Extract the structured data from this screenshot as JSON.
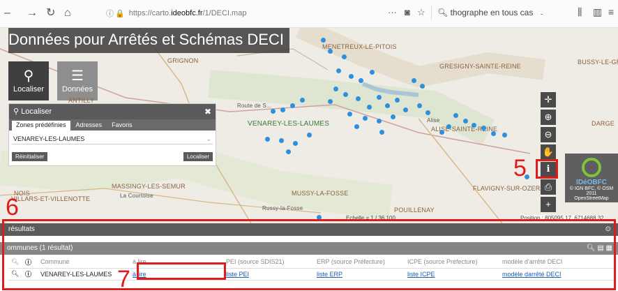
{
  "browser": {
    "url_prefix": "https://carto.",
    "url_host": "ideobfc.fr",
    "url_path": "/1/DECI.map",
    "more": "···",
    "search_text": "thographe en tous cas"
  },
  "app": {
    "title": "Données pour Arrêtés et Schémas DECI",
    "modes": [
      {
        "label": "Localiser"
      },
      {
        "label": "Données"
      }
    ]
  },
  "localiser_panel": {
    "title": "Localiser",
    "tabs": [
      "Zones prédéfinies",
      "Adresses",
      "Favoris"
    ],
    "selected_value": "VENAREY-LES-LAUMES",
    "reset_label": "Réinitialiser",
    "submit_label": "Localiser"
  },
  "map": {
    "places": [
      "GRIGNON",
      "MENETREUX-LE-PITOIS",
      "GRESIGNY-SAINTE-REINE",
      "BUSSY-LE-GRA",
      "VENAREY-LES-LAUMES",
      "ALISE-SAINTE-REINE",
      "DARGE",
      "MASSINGY-LES-SEMUR",
      "MUSSY-LA-FOSSE",
      "FLAVIGNY-SUR-OZERAI",
      "POUILLENAY",
      "VILLARS-ET-VILLENOTTE",
      "NOIS",
      "ANTILLY"
    ],
    "small_places": [
      "Route de S...",
      "Alise",
      "Russy-la-Fosse",
      "La Courtoise"
    ],
    "scale": "Echelle = 1 / 36 100",
    "position": "Position : 805095.17, 6714688.32",
    "logo_text": "IDéOBFC",
    "logo_caption1": "© IGN BFC, © OSM 2011",
    "logo_caption2": "OpenStreetMap"
  },
  "results": {
    "title": "résultats",
    "group_title": "ommunes (1 résultat)",
    "columns": [
      "Commune",
      "à lire",
      "PEI (source SDIS21)",
      "ERP (source Préfecture)",
      "ICPE (source Préfecture)",
      "modèle d'arrêté DECI"
    ],
    "rows": [
      {
        "commune": "VENAREY-LES-LAUMES",
        "a_lire": "à lire",
        "pei": "liste PEI",
        "erp": "liste ERP",
        "icpe": "liste ICPE",
        "modele": "modèle darrêté DECI"
      }
    ]
  },
  "annotations": [
    "5",
    "6",
    "7"
  ]
}
